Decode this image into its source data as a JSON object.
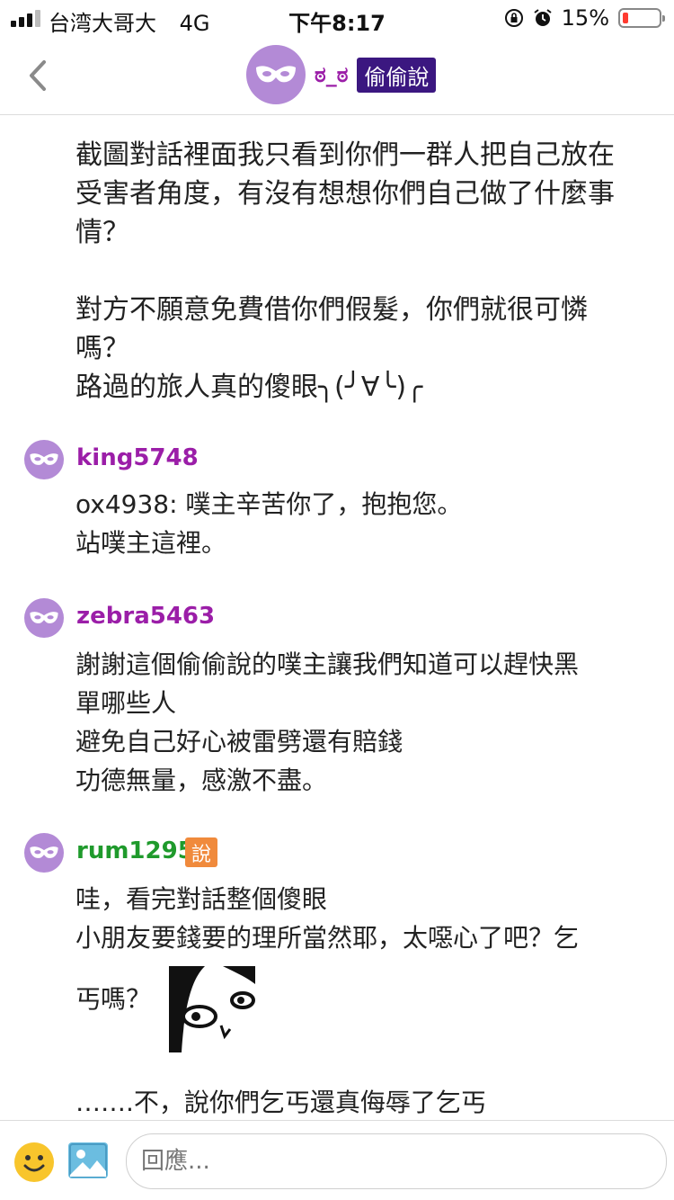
{
  "status_bar": {
    "carrier": "台湾大哥大",
    "network": "4G",
    "time": "下午8:17",
    "battery": "15%",
    "battery_level": 0.15,
    "battery_color": "#ff3b30",
    "icons": [
      "signal-icon",
      "rotation-lock-icon",
      "alarm-icon",
      "battery-icon"
    ]
  },
  "nav": {
    "username": "ಠ_ಠ",
    "tag": "偷偷說",
    "tag_color": "#3b1780",
    "avatar_color": "#b38ad6"
  },
  "post": {
    "lines": [
      "截圖對話裡面我只看到你們一群人把自己放在",
      "受害者角度，有沒有想想你們自己做了什麼事",
      "情？",
      "",
      "對方不願意免費借你們假髮，你們就很可憐",
      "嗎？",
      "路過的旅人真的傻眼╮(╯∀╰)╭"
    ]
  },
  "comments": [
    {
      "name": "king5748",
      "name_color": "#9b1ea8",
      "lines": [
        "ox4938: 噗主辛苦你了，抱抱您。",
        "站噗主這裡。"
      ]
    },
    {
      "name": "zebra5463",
      "name_color": "#9b1ea8",
      "lines": [
        "謝謝這個偷偷說的噗主讓我們知道可以趕快黑",
        "單哪些人",
        "避免自己好心被雷劈還有賠錢",
        "功德無量，感激不盡。"
      ]
    },
    {
      "name": "rum1295",
      "name_color": "#1f9a2c",
      "badge": "說",
      "badge_color": "#f08a3c",
      "lines": [
        "哇，看完對話整個傻眼",
        "小朋友要錢要的理所當然耶，太噁心了吧？乞",
        "丐嗎？",
        "…….不，說你們乞丐還真侮辱了乞丐"
      ]
    }
  ],
  "reply": {
    "placeholder": "回應..."
  }
}
